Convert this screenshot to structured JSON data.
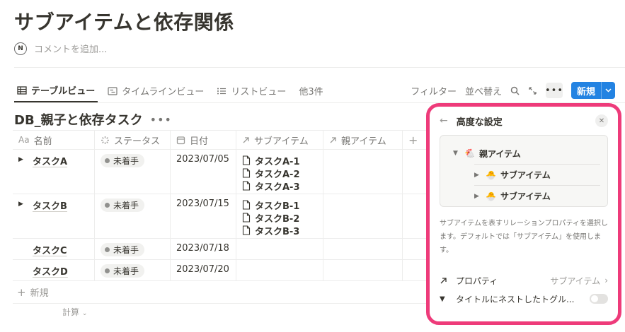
{
  "page": {
    "title": "サブアイテムと依存関係",
    "comment_placeholder": "コメントを追加...",
    "avatar_letter": "N"
  },
  "views": {
    "tabs": [
      {
        "label": "テーブルビュー",
        "icon": "table-icon"
      },
      {
        "label": "タイムラインビュー",
        "icon": "timeline-icon"
      },
      {
        "label": "リストビュー",
        "icon": "list-icon"
      }
    ],
    "more_views": "他3件"
  },
  "toolbar": {
    "filter": "フィルター",
    "sort": "並べ替え",
    "more": "•••",
    "new": "新規"
  },
  "database": {
    "title": "DB_親子と依存タスク",
    "columns": [
      {
        "label": "名前",
        "icon": "Aa"
      },
      {
        "label": "ステータス",
        "icon": "status-icon"
      },
      {
        "label": "日付",
        "icon": "calendar-icon"
      },
      {
        "label": "サブアイテム",
        "icon": "relation-arrow-icon"
      },
      {
        "label": "親アイテム",
        "icon": "relation-arrow-icon"
      }
    ],
    "rows": [
      {
        "name": "タスクA",
        "status": "未着手",
        "date": "2023/07/05",
        "subitems": [
          "タスクA-1",
          "タスクA-2",
          "タスクA-3"
        ],
        "expandable": true
      },
      {
        "name": "タスクB",
        "status": "未着手",
        "date": "2023/07/15",
        "subitems": [
          "タスクB-1",
          "タスクB-2",
          "タスクB-3"
        ],
        "expandable": true
      },
      {
        "name": "タスクC",
        "status": "未着手",
        "date": "2023/07/18",
        "subitems": [],
        "expandable": false
      },
      {
        "name": "タスクD",
        "status": "未着手",
        "date": "2023/07/20",
        "subitems": [],
        "expandable": false
      }
    ],
    "new_row": "新規",
    "calc": "計算"
  },
  "panel": {
    "title": "高度な設定",
    "preview": {
      "parent": "親アイテム",
      "children": [
        "サブアイテム",
        "サブアイテム"
      ]
    },
    "description": "サブアイテムを表すリレーションプロパティを選択します。デフォルトでは「サブアイテム」を使用します。",
    "property_label": "プロパティ",
    "property_value": "サブアイテム",
    "toggle_label": "タイトルにネストしたトグル...",
    "toggle_on": false
  },
  "colors": {
    "accent": "#2383e2",
    "highlight": "#ee3b7a"
  }
}
